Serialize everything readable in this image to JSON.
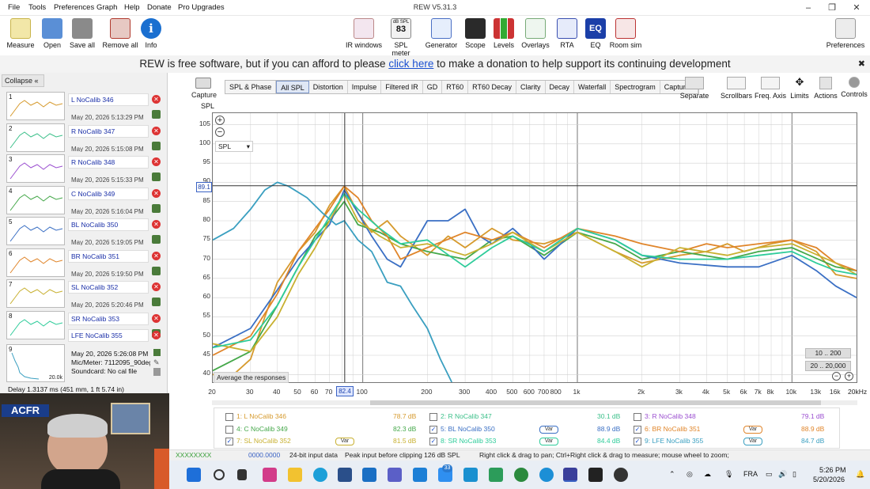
{
  "window": {
    "title": "REW V5.31.3"
  },
  "menu": [
    "File",
    "Tools",
    "Preferences",
    "Graph",
    "Help",
    "Donate",
    "Pro Upgrades"
  ],
  "toolbar_left": [
    {
      "label": "Measure",
      "icon": "measure-icon",
      "color": "#e8c840"
    },
    {
      "label": "Open",
      "icon": "folder-icon",
      "color": "#5a8fd6"
    },
    {
      "label": "Save all",
      "icon": "save-icon",
      "color": "#666"
    },
    {
      "label": "Remove all",
      "icon": "remove-icon",
      "color": "#b03a2e"
    },
    {
      "label": "Info",
      "icon": "info-icon",
      "color": "#1a6fd0"
    }
  ],
  "toolbar_center": [
    {
      "label": "IR windows",
      "icon": "ir-windows-icon"
    },
    {
      "label": "SPL meter",
      "icon": "spl-meter-icon",
      "top": "dB SPL",
      "value": "83"
    },
    {
      "label": "Generator",
      "icon": "generator-icon"
    },
    {
      "label": "Scope",
      "icon": "scope-icon"
    },
    {
      "label": "Levels",
      "icon": "levels-icon"
    },
    {
      "label": "Overlays",
      "icon": "overlays-icon"
    },
    {
      "label": "RTA",
      "icon": "rta-icon"
    },
    {
      "label": "EQ",
      "icon": "eq-icon"
    },
    {
      "label": "Room sim",
      "icon": "room-sim-icon"
    }
  ],
  "toolbar_right": {
    "label": "Preferences"
  },
  "donation": {
    "before": "REW is free software, but if you can afford to please ",
    "link": "click here",
    "after": " to make a donation to help support its continuing development"
  },
  "sidebar": {
    "collapse_label": "Collapse",
    "measurements": [
      {
        "num": "1",
        "name": "L NoCalib 346",
        "date": "May 20, 2026 5:13:29 PM",
        "color": "#d69a2d"
      },
      {
        "num": "2",
        "name": "R NoCalib 347",
        "date": "May 20, 2026 5:15:08 PM",
        "color": "#3cc08a"
      },
      {
        "num": "3",
        "name": "R NoCalib 348",
        "date": "May 20, 2026 5:15:33 PM",
        "color": "#9b4fd0"
      },
      {
        "num": "4",
        "name": "C NoCalib 349",
        "date": "May 20, 2026 5:16:04 PM",
        "color": "#45a84a"
      },
      {
        "num": "5",
        "name": "BL NoCalib 350",
        "date": "May 20, 2026 5:19:05 PM",
        "color": "#3a6fc4"
      },
      {
        "num": "6",
        "name": "BR NoCalib 351",
        "date": "May 20, 2026 5:19:50 PM",
        "color": "#e0852a"
      },
      {
        "num": "7",
        "name": "SL NoCalib 352",
        "date": "May 20, 2026 5:20:46 PM",
        "color": "#c8b030"
      },
      {
        "num": "8",
        "name": "SR NoCalib 353",
        "date": "May 20, 2026 5:21:19 PM",
        "color": "#2ecc9a"
      }
    ],
    "active": {
      "num": "9",
      "name": "LFE NoCalib 355",
      "date": "May 20, 2026 5:26:08 PM",
      "mic": "Mic/Meter: 7112095_90deg",
      "soundcard": "Soundcard: No cal file",
      "thumb_label": "20.0k"
    },
    "delay": "Delay 1.3137 ms (451 mm, 1 ft 5.74 in)"
  },
  "graph": {
    "capture_label": "Capture",
    "tabs": [
      "SPL & Phase",
      "All SPL",
      "Distortion",
      "Impulse",
      "Filtered IR",
      "GD",
      "RT60",
      "RT60 Decay",
      "Clarity",
      "Decay",
      "Waterfall",
      "Spectrogram",
      "Captured"
    ],
    "active_tab": "All SPL",
    "right_tools": [
      "Separate",
      "Scrollbars",
      "Freq. Axis",
      "Limits",
      "Actions",
      "Controls"
    ],
    "y_unit": "SPL",
    "spl_select": "SPL",
    "cursor_y": "89.1",
    "cursor_x": "82.4",
    "average_label": "Average the responses",
    "range_buttons": [
      "10 .. 200",
      "20 .. 20,000"
    ],
    "khz_label": "20kHz"
  },
  "chart_data": {
    "type": "line",
    "xscale": "log",
    "xlim": [
      20,
      20000
    ],
    "ylim": [
      38,
      108
    ],
    "grid": true,
    "y_ticks": [
      40,
      45,
      50,
      55,
      60,
      65,
      70,
      75,
      80,
      85,
      90,
      95,
      100,
      105
    ],
    "x_ticks": [
      "20",
      "30",
      "40",
      "50",
      "60",
      "70",
      "100",
      "200",
      "300",
      "400",
      "500",
      "600",
      "700",
      "800",
      "1k",
      "2k",
      "3k",
      "4k",
      "5k",
      "6k",
      "7k",
      "8k",
      "10k",
      "13k",
      "16k"
    ],
    "series": [
      {
        "name": "L NoCalib 346",
        "color": "#d69a2d",
        "points": [
          [
            20,
            40
          ],
          [
            25,
            40
          ],
          [
            30,
            44
          ],
          [
            35,
            55
          ],
          [
            40,
            64
          ],
          [
            50,
            72
          ],
          [
            60,
            77
          ],
          [
            70,
            84
          ],
          [
            82,
            89
          ],
          [
            95,
            82
          ],
          [
            110,
            77
          ],
          [
            130,
            80
          ],
          [
            150,
            76
          ],
          [
            200,
            71
          ],
          [
            250,
            76
          ],
          [
            300,
            73
          ],
          [
            400,
            78
          ],
          [
            500,
            75
          ],
          [
            700,
            74
          ],
          [
            1000,
            77
          ],
          [
            1500,
            72
          ],
          [
            2000,
            69
          ],
          [
            3000,
            71
          ],
          [
            4000,
            72
          ],
          [
            5000,
            74
          ],
          [
            6000,
            72
          ],
          [
            8000,
            74
          ],
          [
            10000,
            75
          ],
          [
            13000,
            72
          ],
          [
            16000,
            66
          ],
          [
            20000,
            65
          ]
        ]
      },
      {
        "name": "C NoCalib 349",
        "color": "#45a84a",
        "points": [
          [
            20,
            41
          ],
          [
            30,
            46
          ],
          [
            40,
            58
          ],
          [
            50,
            68
          ],
          [
            60,
            76
          ],
          [
            70,
            80
          ],
          [
            82,
            85
          ],
          [
            95,
            79
          ],
          [
            120,
            77
          ],
          [
            150,
            74
          ],
          [
            200,
            72
          ],
          [
            300,
            70
          ],
          [
            400,
            75
          ],
          [
            500,
            76
          ],
          [
            700,
            71
          ],
          [
            1000,
            77
          ],
          [
            1500,
            74
          ],
          [
            2000,
            70
          ],
          [
            3000,
            72
          ],
          [
            5000,
            70
          ],
          [
            7000,
            72
          ],
          [
            10000,
            73
          ],
          [
            16000,
            68
          ],
          [
            20000,
            67
          ]
        ]
      },
      {
        "name": "BL NoCalib 350",
        "color": "#3a6fc4",
        "points": [
          [
            20,
            47
          ],
          [
            30,
            52
          ],
          [
            40,
            62
          ],
          [
            50,
            70
          ],
          [
            60,
            75
          ],
          [
            70,
            79
          ],
          [
            82,
            88
          ],
          [
            95,
            82
          ],
          [
            110,
            76
          ],
          [
            130,
            70
          ],
          [
            150,
            68
          ],
          [
            200,
            80
          ],
          [
            250,
            80
          ],
          [
            300,
            83
          ],
          [
            350,
            76
          ],
          [
            400,
            74
          ],
          [
            500,
            78
          ],
          [
            600,
            74
          ],
          [
            700,
            70
          ],
          [
            1000,
            78
          ],
          [
            1500,
            75
          ],
          [
            2000,
            71
          ],
          [
            3000,
            69
          ],
          [
            5000,
            68
          ],
          [
            7000,
            68
          ],
          [
            10000,
            71
          ],
          [
            13000,
            67
          ],
          [
            16000,
            63
          ],
          [
            20000,
            60
          ]
        ]
      },
      {
        "name": "BR NoCalib 351",
        "color": "#e0852a",
        "points": [
          [
            20,
            45
          ],
          [
            30,
            50
          ],
          [
            40,
            61
          ],
          [
            50,
            72
          ],
          [
            60,
            78
          ],
          [
            70,
            83
          ],
          [
            82,
            89
          ],
          [
            95,
            86
          ],
          [
            110,
            80
          ],
          [
            130,
            76
          ],
          [
            150,
            70
          ],
          [
            200,
            73
          ],
          [
            300,
            77
          ],
          [
            400,
            75
          ],
          [
            500,
            77
          ],
          [
            700,
            73
          ],
          [
            1000,
            78
          ],
          [
            1500,
            76
          ],
          [
            2000,
            74
          ],
          [
            3000,
            72
          ],
          [
            4000,
            74
          ],
          [
            5000,
            73
          ],
          [
            7000,
            74
          ],
          [
            10000,
            75
          ],
          [
            13000,
            73
          ],
          [
            16000,
            69
          ],
          [
            20000,
            67
          ]
        ]
      },
      {
        "name": "SL NoCalib 352",
        "color": "#c8b030",
        "points": [
          [
            20,
            48
          ],
          [
            30,
            46
          ],
          [
            40,
            55
          ],
          [
            50,
            66
          ],
          [
            60,
            73
          ],
          [
            70,
            80
          ],
          [
            82,
            87
          ],
          [
            95,
            80
          ],
          [
            120,
            76
          ],
          [
            150,
            73
          ],
          [
            200,
            74
          ],
          [
            300,
            71
          ],
          [
            400,
            74
          ],
          [
            500,
            77
          ],
          [
            700,
            72
          ],
          [
            1000,
            77
          ],
          [
            1500,
            72
          ],
          [
            2000,
            68
          ],
          [
            3000,
            73
          ],
          [
            5000,
            71
          ],
          [
            7000,
            73
          ],
          [
            10000,
            74
          ],
          [
            16000,
            69
          ],
          [
            20000,
            66
          ]
        ]
      },
      {
        "name": "SR NoCalib 353",
        "color": "#2ecc9a",
        "points": [
          [
            20,
            47
          ],
          [
            30,
            49
          ],
          [
            40,
            58
          ],
          [
            50,
            68
          ],
          [
            60,
            75
          ],
          [
            70,
            81
          ],
          [
            82,
            87
          ],
          [
            95,
            83
          ],
          [
            120,
            78
          ],
          [
            150,
            74
          ],
          [
            200,
            75
          ],
          [
            300,
            68
          ],
          [
            400,
            73
          ],
          [
            500,
            76
          ],
          [
            700,
            72
          ],
          [
            1000,
            78
          ],
          [
            1500,
            75
          ],
          [
            2000,
            71
          ],
          [
            3000,
            70
          ],
          [
            5000,
            70
          ],
          [
            7000,
            71
          ],
          [
            10000,
            72
          ],
          [
            13000,
            69
          ],
          [
            16000,
            67
          ],
          [
            20000,
            66
          ]
        ]
      },
      {
        "name": "LFE NoCalib 355",
        "color": "#3a9fc0",
        "points": [
          [
            20,
            75
          ],
          [
            25,
            78
          ],
          [
            30,
            83
          ],
          [
            35,
            88
          ],
          [
            40,
            90
          ],
          [
            45,
            89
          ],
          [
            55,
            86
          ],
          [
            65,
            82
          ],
          [
            75,
            79
          ],
          [
            82,
            80
          ],
          [
            95,
            75
          ],
          [
            110,
            72
          ],
          [
            130,
            64
          ],
          [
            150,
            63
          ],
          [
            170,
            58
          ],
          [
            200,
            52
          ],
          [
            230,
            44
          ],
          [
            260,
            38
          ]
        ]
      }
    ]
  },
  "legend": [
    {
      "id": "1",
      "name": "1: L NoCalib 346",
      "value": "78.7 dB",
      "checked": false,
      "color": "#d69a2d",
      "var": false
    },
    {
      "id": "2",
      "name": "2: R NoCalib 347",
      "value": "30.1 dB",
      "checked": false,
      "color": "#3cc08a",
      "var": false
    },
    {
      "id": "3",
      "name": "3: R NoCalib 348",
      "value": "79.1 dB",
      "checked": false,
      "color": "#9b4fd0",
      "var": false
    },
    {
      "id": "4",
      "name": "4: C NoCalib 349",
      "value": "82.3 dB",
      "checked": false,
      "color": "#45a84a",
      "var": false
    },
    {
      "id": "5",
      "name": "5: BL NoCalib 350",
      "value": "88.9 dB",
      "checked": true,
      "color": "#3a6fc4",
      "var": true
    },
    {
      "id": "6",
      "name": "6: BR NoCalib 351",
      "value": "88.9 dB",
      "checked": true,
      "color": "#e0852a",
      "var": true
    },
    {
      "id": "7",
      "name": "7: SL NoCalib 352",
      "value": "81.5 dB",
      "checked": true,
      "color": "#c8b030",
      "var": true
    },
    {
      "id": "8",
      "name": "8: SR NoCalib 353",
      "value": "84.4 dB",
      "checked": true,
      "color": "#2ecc9a",
      "var": true
    },
    {
      "id": "9",
      "name": "9: LFE NoCalib 355",
      "value": "84.7 dB",
      "checked": true,
      "color": "#3a9fc0",
      "var": true
    }
  ],
  "var_label": "Var",
  "status": {
    "peak_value": "0000.0000",
    "input": "24-bit input data",
    "clip": "Peak input before clipping 126 dB SPL",
    "hint": "Right click & drag to pan; Ctrl+Right click & drag to measure; mouse wheel to zoom;"
  },
  "taskbar": {
    "lang": "FRA",
    "time": "5:26 PM",
    "date": "5/20/2026",
    "badge": "33"
  }
}
